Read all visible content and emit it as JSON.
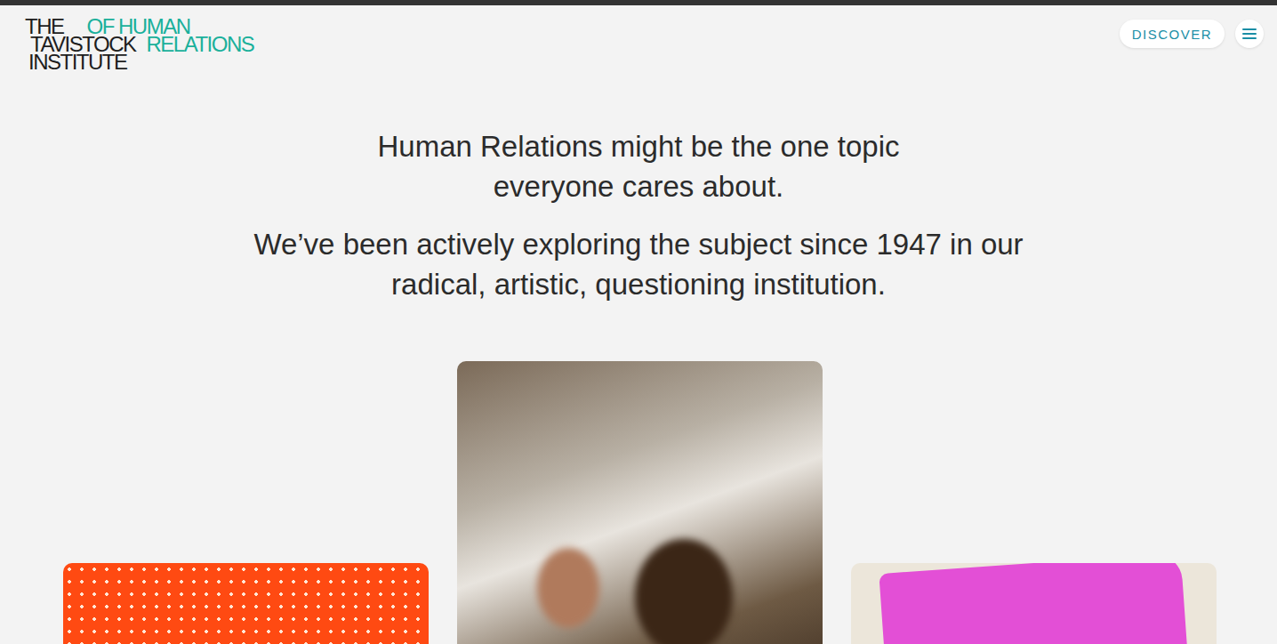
{
  "logo": {
    "lines": [
      {
        "dark": "THE",
        "teal": "OF HUMAN"
      },
      {
        "dark": "TAVISTOCK",
        "teal": "RELATIONS"
      },
      {
        "dark": "INSTITUTE",
        "teal": ""
      }
    ]
  },
  "header": {
    "discover": "DISCOVER"
  },
  "intro": [
    {
      "lines": [
        "Human Relations might be the one topic",
        "everyone cares about."
      ]
    },
    {
      "lines": [
        "We’ve been actively exploring the subject since 1947 in our",
        "radical, artistic, questioning institution."
      ]
    }
  ],
  "cards": [
    {
      "kind": "burst"
    },
    {
      "kind": "photo"
    },
    {
      "kind": "collage"
    }
  ]
}
